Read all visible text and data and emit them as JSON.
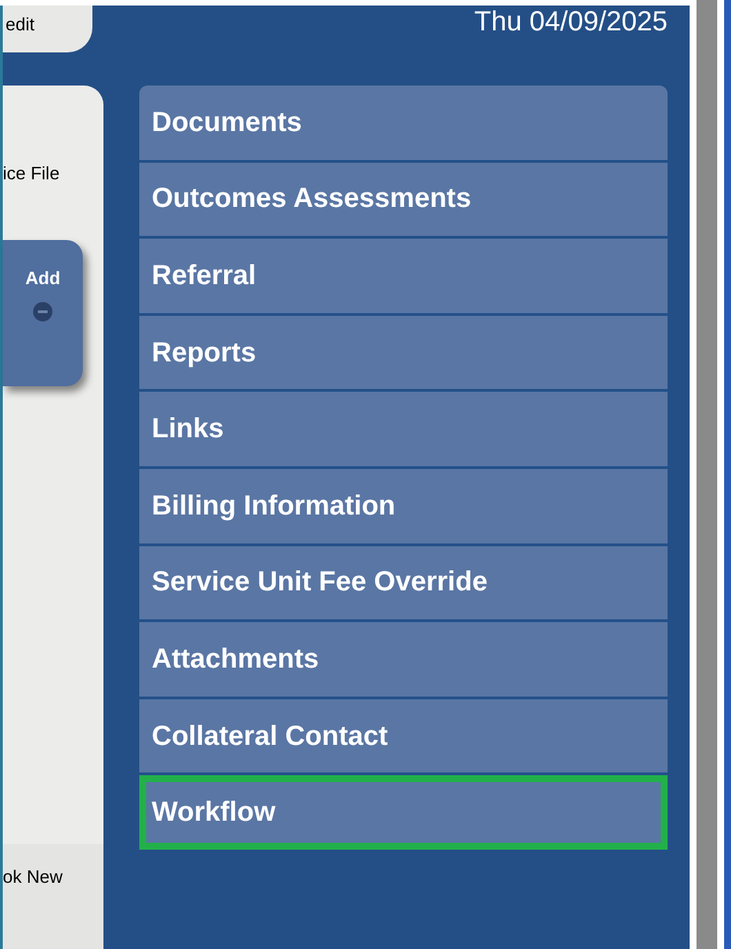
{
  "header": {
    "edit_label": "edit",
    "date": "Thu 04/09/2025"
  },
  "left_panel": {
    "service_label": "ice File",
    "add_button": "Add",
    "bottom_label": "ok New"
  },
  "menu": [
    {
      "label": "Documents",
      "highlighted": false
    },
    {
      "label": "Outcomes Assessments",
      "highlighted": false
    },
    {
      "label": "Referral",
      "highlighted": false
    },
    {
      "label": "Reports",
      "highlighted": false
    },
    {
      "label": "Links",
      "highlighted": false
    },
    {
      "label": "Billing Information",
      "highlighted": false
    },
    {
      "label": "Service Unit Fee Override",
      "highlighted": false
    },
    {
      "label": "Attachments",
      "highlighted": false
    },
    {
      "label": "Collateral Contact",
      "highlighted": false
    },
    {
      "label": "Workflow",
      "highlighted": true
    }
  ]
}
